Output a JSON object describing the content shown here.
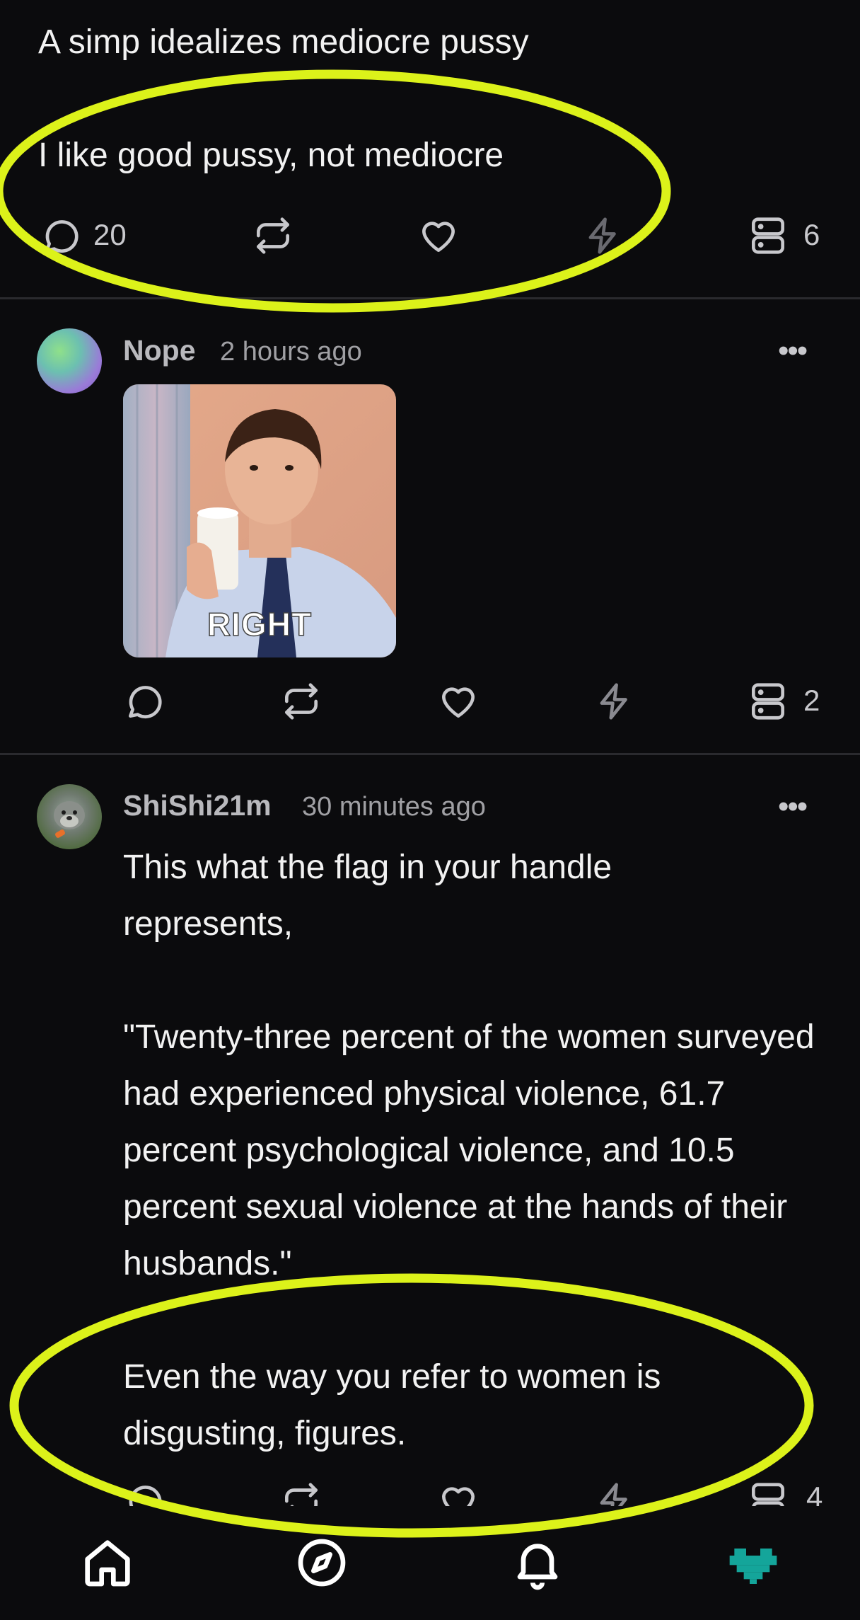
{
  "post_top": {
    "line1": "A simp idealizes mediocre pussy",
    "line2": "I like good pussy, not mediocre",
    "reply_count": "20",
    "stack_count": "6"
  },
  "post_nope": {
    "username": "Nope",
    "time": "2 hours ago",
    "more": "•••",
    "gif_caption": "RIGHT",
    "stack_count": "2"
  },
  "post_shishi": {
    "username": "ShiShi21m",
    "time": "30 minutes ago",
    "more": "•••",
    "para1": "This what the flag in your handle represents,",
    "para2": "\"Twenty-three percent of the women surveyed had experienced physical violence, 61.7 percent psychological violence, and 10.5 percent sexual violence at the hands of their husbands.\"",
    "para3": "Even the way you refer to women is disgusting, figures.",
    "stack_count": "4"
  },
  "colors": {
    "background": "#0b0b0d",
    "highlight_ellipse": "#dcf21a",
    "accent_teal": "#14a59a"
  },
  "icons": [
    "comment-icon",
    "repost-icon",
    "heart-icon",
    "zap-icon",
    "stack-icon",
    "home-icon",
    "compass-icon",
    "bell-icon",
    "heart-pixel-icon"
  ]
}
